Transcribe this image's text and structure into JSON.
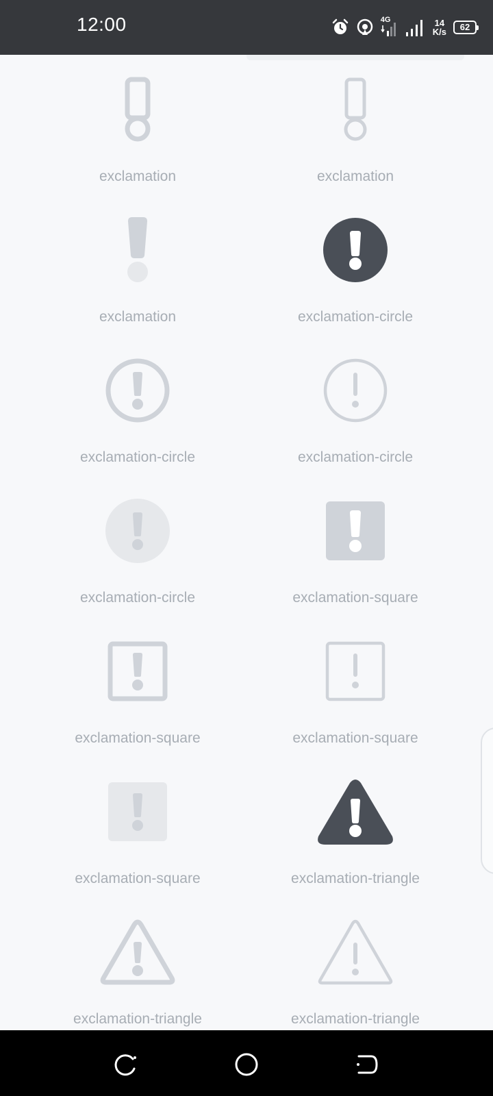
{
  "status_bar": {
    "time": "12:00",
    "network_type": "4G",
    "net_speed_value": "14",
    "net_speed_unit": "K/s",
    "battery_level": "62"
  },
  "icons": [
    {
      "label": "exclamation",
      "icon": "exclamation-outline-bold"
    },
    {
      "label": "exclamation",
      "icon": "exclamation-outline-thin"
    },
    {
      "label": "exclamation",
      "icon": "exclamation-solid-light"
    },
    {
      "label": "exclamation-circle",
      "icon": "exclamation-circle-solid-dark"
    },
    {
      "label": "exclamation-circle",
      "icon": "exclamation-circle-outline-bold"
    },
    {
      "label": "exclamation-circle",
      "icon": "exclamation-circle-outline-thin"
    },
    {
      "label": "exclamation-circle",
      "icon": "exclamation-circle-solid-light"
    },
    {
      "label": "exclamation-square",
      "icon": "exclamation-square-solid-medium"
    },
    {
      "label": "exclamation-square",
      "icon": "exclamation-square-outline-bold"
    },
    {
      "label": "exclamation-square",
      "icon": "exclamation-square-outline-thin"
    },
    {
      "label": "exclamation-square",
      "icon": "exclamation-square-solid-light"
    },
    {
      "label": "exclamation-triangle",
      "icon": "exclamation-triangle-solid-dark"
    },
    {
      "label": "exclamation-triangle",
      "icon": "exclamation-triangle-outline-bold"
    },
    {
      "label": "exclamation-triangle",
      "icon": "exclamation-triangle-outline-thin"
    }
  ],
  "colors": {
    "icon_dark": "#4a4f57",
    "icon_medium": "#cfd3d9",
    "icon_light": "#e6e8eb",
    "label": "#a7adb4",
    "background": "#f7f8fa"
  }
}
